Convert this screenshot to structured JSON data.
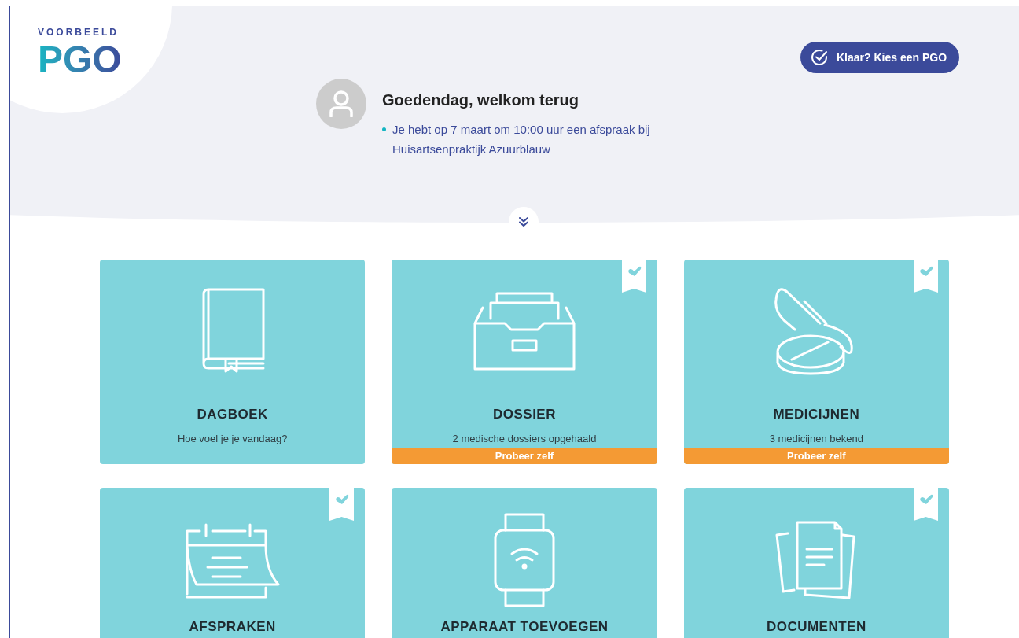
{
  "logo": {
    "tagline": "VOORBEELD",
    "name": "PGO"
  },
  "header_button": {
    "label": "Klaar? Kies een PGO"
  },
  "greeting": {
    "title": "Goedendag, welkom terug",
    "notices": [
      "Je hebt op 7 maart om 10:00 uur een afspraak bij Huisartsenpraktijk Azuurblauw"
    ]
  },
  "cards": [
    {
      "kind": "book",
      "title": "DAGBOEK",
      "subtitle": "Hoe voel je je vandaag?",
      "checked": false
    },
    {
      "kind": "drawer",
      "title": "DOSSIER",
      "subtitle": "2 medische dossiers opgehaald",
      "checked": true,
      "banner": "Probeer zelf"
    },
    {
      "kind": "pills",
      "title": "MEDICIJNEN",
      "subtitle": "3 medicijnen bekend",
      "checked": true,
      "banner": "Probeer zelf"
    },
    {
      "kind": "calendar",
      "title": "AFSPRAKEN",
      "checked": true
    },
    {
      "kind": "watch",
      "title": "APPARAAT TOEVOEGEN",
      "checked": false
    },
    {
      "kind": "documents",
      "title": "DOCUMENTEN",
      "checked": true
    }
  ]
}
